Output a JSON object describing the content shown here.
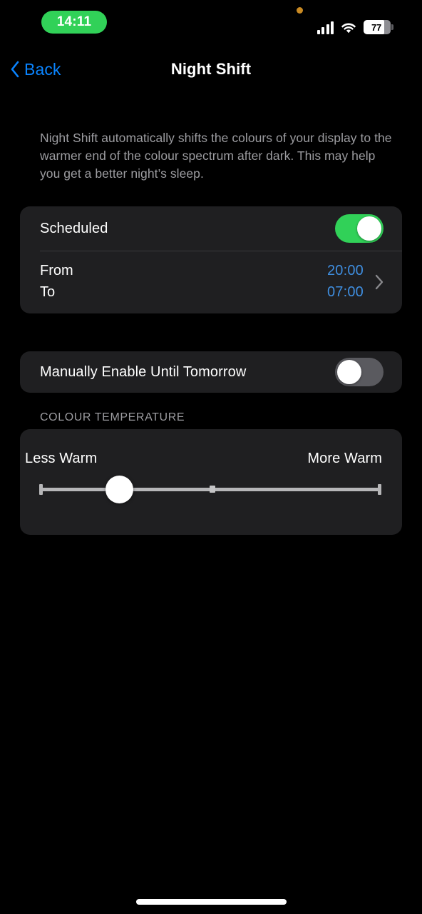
{
  "status_bar": {
    "time": "14:11",
    "time_pill_color": "#31D158",
    "privacy_indicator": "orange-privacy-dot",
    "signal_icon": "cellular-signal-icon",
    "signal_bars": 4,
    "wifi_icon": "wifi-icon",
    "battery_percent": "77",
    "battery_level": 77
  },
  "nav": {
    "back_label": "Back",
    "back_icon": "chevron-left-icon",
    "title": "Night Shift",
    "accent_color": "#0A84FF"
  },
  "description": "Night Shift automatically shifts the colours of your display to the warmer end of the colour spectrum after dark. This may help you get a better night’s sleep.",
  "scheduled_card": {
    "scheduled": {
      "label": "Scheduled",
      "toggle_state": "on",
      "toggle_on_color": "#31D158"
    },
    "schedule": {
      "from_label": "From",
      "from_value": "20:00",
      "to_label": "To",
      "to_value": "07:00",
      "value_color": "#3F8EE0",
      "disclosure_icon": "chevron-right-icon"
    }
  },
  "manual_card": {
    "label": "Manually Enable Until Tomorrow",
    "toggle_state": "off",
    "toggle_off_color": "#5A5A5F"
  },
  "colour_temperature": {
    "section_header": "COLOUR TEMPERATURE",
    "less_warm_label": "Less Warm",
    "more_warm_label": "More Warm",
    "slider_value_percent": 21,
    "slider_midpoint_tick": true
  },
  "home_indicator": "home-indicator"
}
